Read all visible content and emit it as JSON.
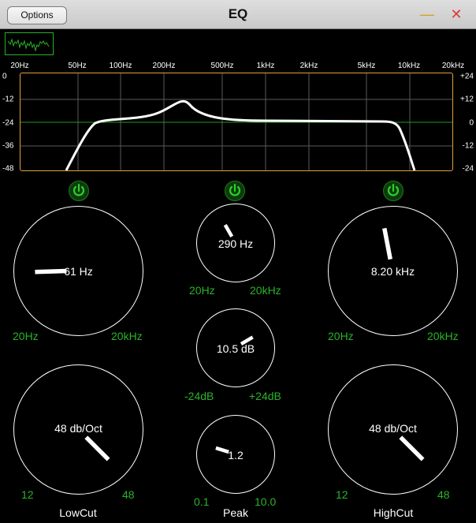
{
  "window": {
    "title": "EQ",
    "options_label": "Options",
    "minimize_glyph": "—",
    "close_glyph": "✕"
  },
  "graph": {
    "freq_labels": [
      "20Hz",
      "50Hz",
      "100Hz",
      "200Hz",
      "500Hz",
      "1kHz",
      "2kHz",
      "5kHz",
      "10kHz",
      "20kHz"
    ],
    "db_left_labels": [
      "0",
      "-12",
      "-24",
      "-36",
      "-48"
    ],
    "db_right_labels": [
      "+24",
      "+12",
      "0",
      "-12",
      "-24"
    ]
  },
  "lowcut": {
    "label": "LowCut",
    "freq_value": "61 Hz",
    "freq_min": "20Hz",
    "freq_max": "20kHz",
    "freq_level": 0.16,
    "slope_value": "48 db/Oct",
    "slope_min": "12",
    "slope_max": "48",
    "slope_level": 1.0
  },
  "peak": {
    "label": "Peak",
    "freq_value": "290 Hz",
    "freq_min": "20Hz",
    "freq_max": "20kHz",
    "freq_level": 0.39,
    "gain_value": "10.5 dB",
    "gain_min": "-24dB",
    "gain_max": "+24dB",
    "gain_level": 0.72,
    "q_value": "1.2",
    "q_min": "0.1",
    "q_max": "10.0",
    "q_level": 0.23
  },
  "highcut": {
    "label": "HighCut",
    "freq_value": "8.20 kHz",
    "freq_min": "20Hz",
    "freq_max": "20kHz",
    "freq_level": 0.46,
    "slope_value": "48 db/Oct",
    "slope_min": "12",
    "slope_max": "48",
    "slope_level": 1.0
  },
  "colors": {
    "accent_green": "#28b428",
    "graph_border": "#e3a13a",
    "close_red": "#e03a3a",
    "minimize_yellow": "#d4a018"
  },
  "icons": {
    "power": "power-icon",
    "scope": "spectrum-analyzer-icon"
  }
}
